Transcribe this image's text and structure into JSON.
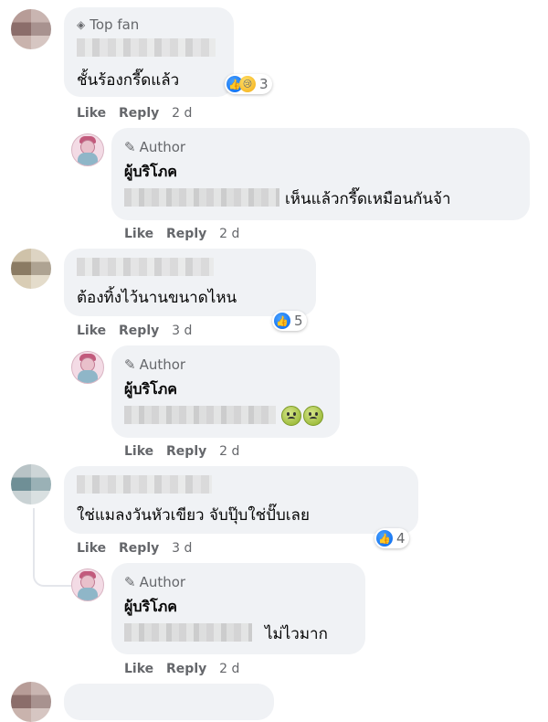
{
  "comments": [
    {
      "badge": "Top fan",
      "text": "ชั้นร้องกรี๊ดแล้ว",
      "reaction_count": "3",
      "like": "Like",
      "reply": "Reply",
      "time": "2 d",
      "icons": [
        "like-icon",
        "sad-icon"
      ],
      "reply_item": {
        "badge": "Author",
        "name": "ผู้บริโภค",
        "text": "เห็นแล้วกรี๊ดเหมือนกันจ้า",
        "like": "Like",
        "reply": "Reply",
        "time": "2 d"
      }
    },
    {
      "text": "ต้องทิ้งไว้นานขนาดไหน",
      "reaction_count": "5",
      "like": "Like",
      "reply": "Reply",
      "time": "3 d",
      "reply_item": {
        "badge": "Author",
        "name": "ผู้บริโภค",
        "text": "",
        "like": "Like",
        "reply": "Reply",
        "time": "2 d"
      }
    },
    {
      "text": "ใช่แมลงวันหัวเขียว จับปุ๊บใช่ปั๊บเลย",
      "reaction_count": "4",
      "like": "Like",
      "reply": "Reply",
      "time": "3 d",
      "reply_item": {
        "badge": "Author",
        "name": "ผู้บริโภค",
        "text": "ไม่ไวมาก",
        "like": "Like",
        "reply": "Reply",
        "time": "2 d"
      }
    }
  ],
  "colors": {
    "bubble": "#f0f2f5",
    "meta": "#65676b",
    "like_blue": "#1877f2"
  }
}
